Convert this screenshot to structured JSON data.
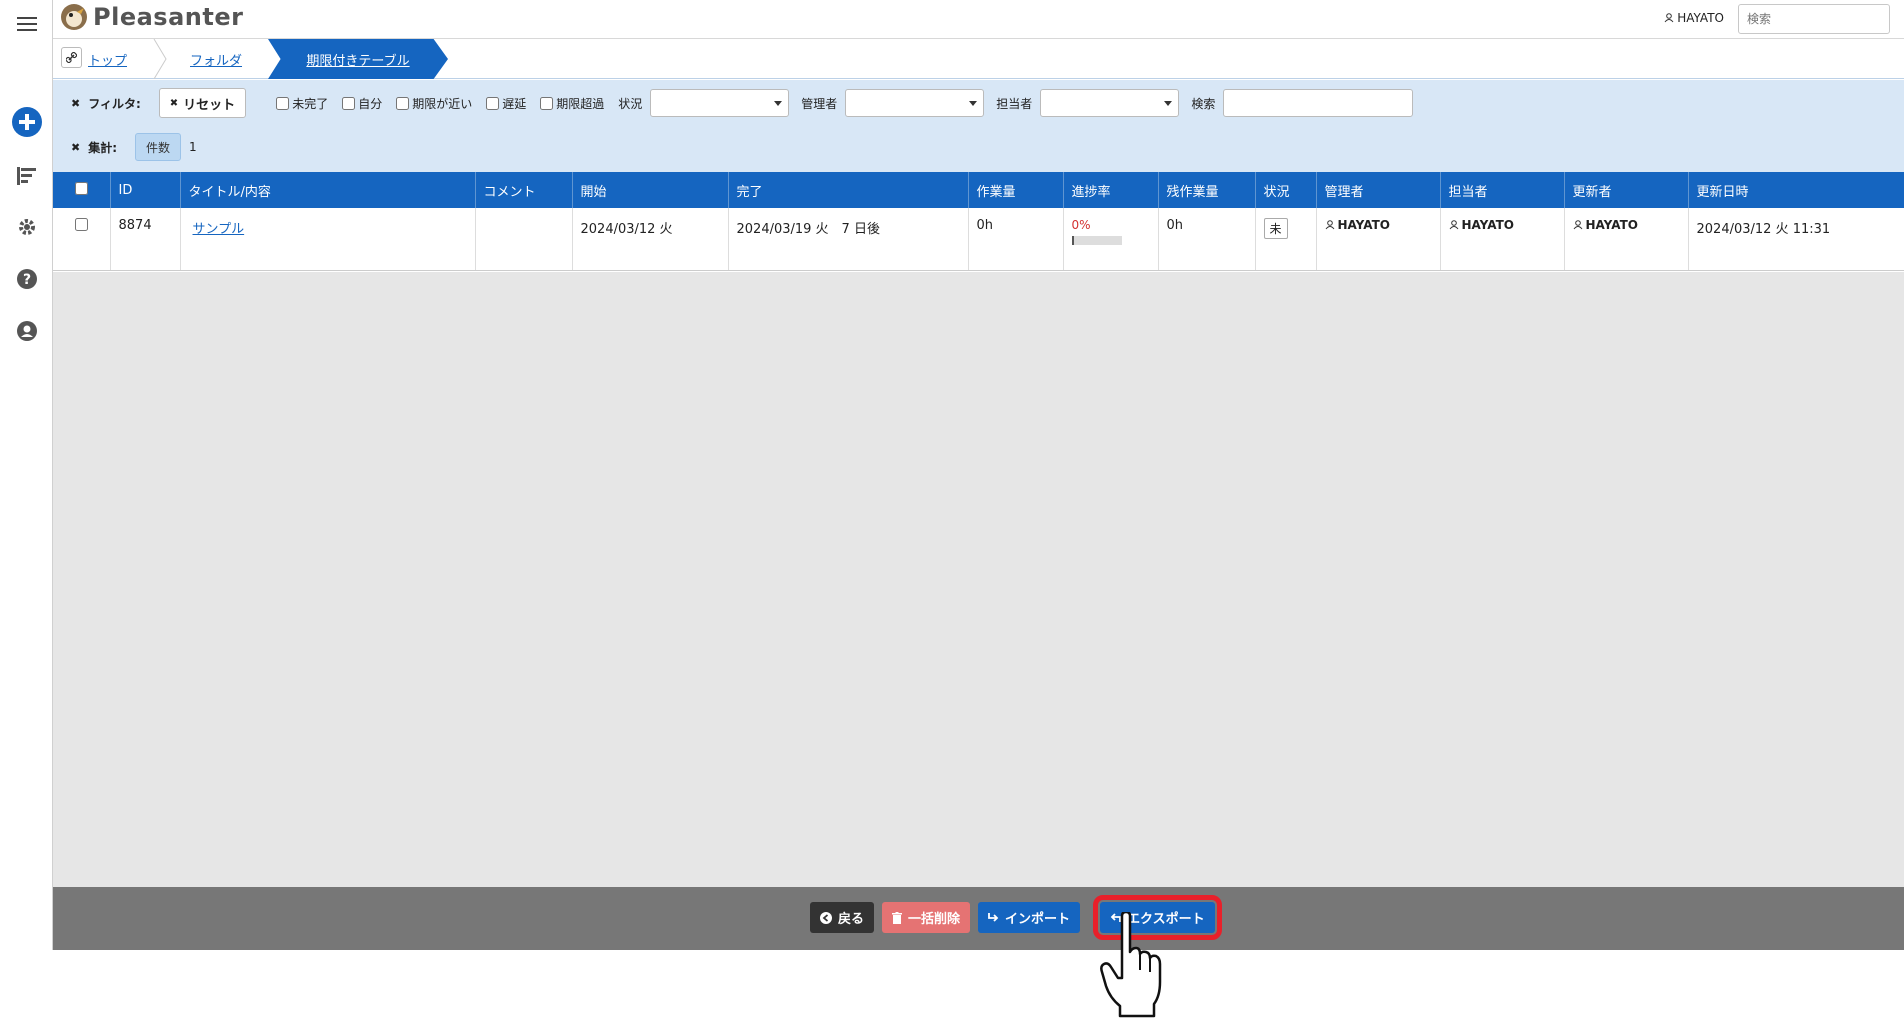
{
  "header": {
    "logo_text": "Pleasanter",
    "user_name": "HAYATO",
    "search_placeholder": "検索"
  },
  "breadcrumb": {
    "items": [
      "トップ",
      "フォルダ"
    ],
    "current": "期限付きテーブル"
  },
  "filters": {
    "label": "フィルタ:",
    "reset_label": "リセット",
    "checkboxes": [
      "未完了",
      "自分",
      "期限が近い",
      "遅延",
      "期限超過"
    ],
    "status_label": "状況",
    "manager_label": "管理者",
    "owner_label": "担当者",
    "search_label": "検索"
  },
  "aggregation": {
    "label": "集計:",
    "count_label": "件数",
    "count_value": "1"
  },
  "table": {
    "columns": [
      "ID",
      "タイトル/内容",
      "コメント",
      "開始",
      "完了",
      "作業量",
      "進捗率",
      "残作業量",
      "状況",
      "管理者",
      "担当者",
      "更新者",
      "更新日時"
    ],
    "rows": [
      {
        "id": "8874",
        "title": "サンプル",
        "comment": "",
        "start": "2024/03/12 火",
        "complete": "2024/03/19 火　7 日後",
        "work_value": "0h",
        "progress_rate": "0%",
        "progress_fraction": 0,
        "remaining": "0h",
        "status": "未",
        "manager": "HAYATO",
        "owner": "HAYATO",
        "updator": "HAYATO",
        "updated_time": "2024/03/12 火 11:31"
      }
    ]
  },
  "footer": {
    "back_label": "戻る",
    "bulk_delete_label": "一括削除",
    "import_label": "インポート",
    "export_label": "エクスポート"
  },
  "colors": {
    "primary": "#1565c0",
    "filter_bg": "#d8e7f6",
    "footer_bg": "#777777",
    "highlight": "#e8202a",
    "delete": "#e57373"
  }
}
